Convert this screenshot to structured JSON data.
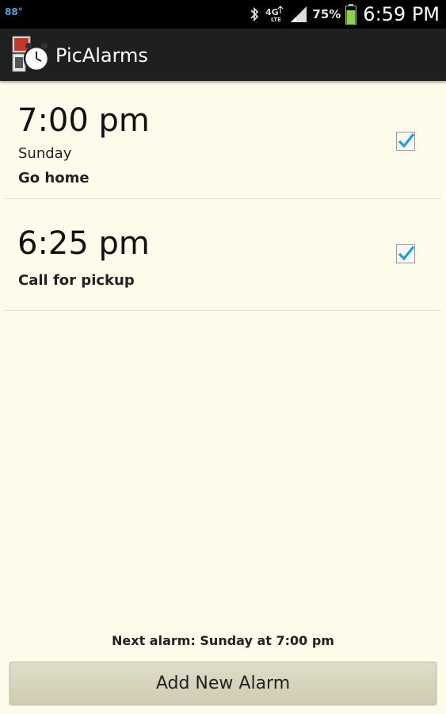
{
  "status_bar": {
    "temperature": "88°",
    "battery_percent": "75%",
    "time": "6:59 PM",
    "icons": [
      "bluetooth-icon",
      "4g-lte-icon",
      "signal-icon",
      "battery-icon"
    ]
  },
  "app": {
    "title": "PicAlarms",
    "icon": "picalarms-app-icon"
  },
  "alarms": [
    {
      "time": "7:00 pm",
      "day": "Sunday",
      "label": "Go home",
      "enabled": true
    },
    {
      "time": "6:25 pm",
      "day": "",
      "label": "Call for pickup",
      "enabled": true
    }
  ],
  "footer": {
    "next_alarm": "Next alarm: Sunday at 7:00 pm",
    "add_button_label": "Add New Alarm"
  },
  "colors": {
    "background": "#fdfbea",
    "action_bar": "#1f1f1f",
    "checkbox_accent": "#1e9fe0",
    "button": "#d8d4bd"
  }
}
